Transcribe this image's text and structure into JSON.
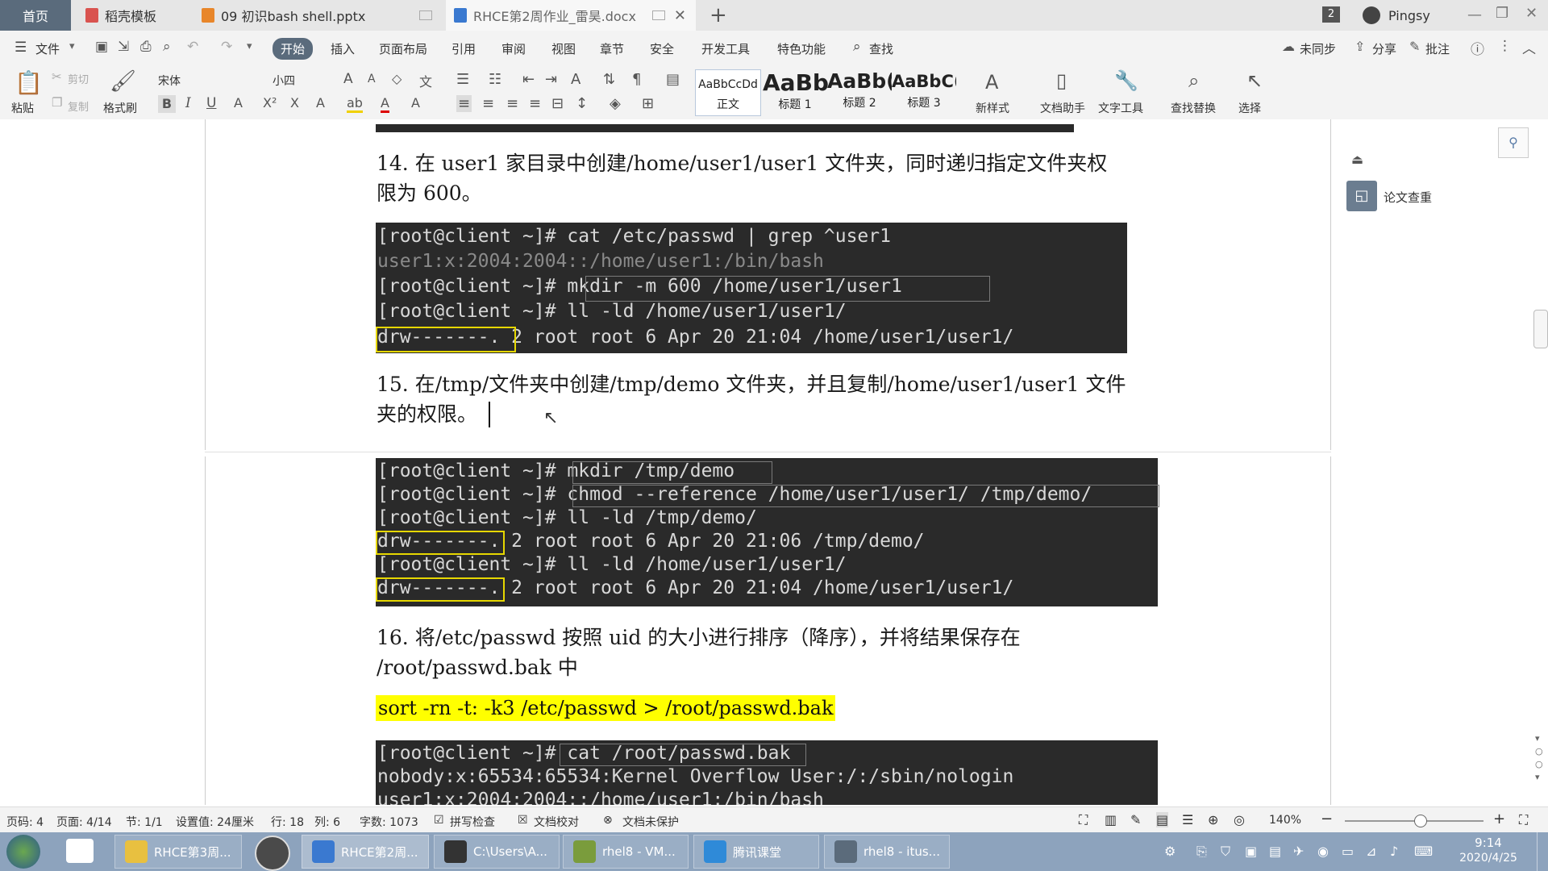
{
  "tabs": [
    {
      "label": "首页"
    },
    {
      "label": "稻壳模板"
    },
    {
      "label": "09 初识bash shell.pptx"
    },
    {
      "label": "RHCE第2周作业_雷昊.docx"
    }
  ],
  "titlebar": {
    "badge": "2",
    "user": "Pingsy"
  },
  "menu": [
    "文件",
    "开始",
    "插入",
    "页面布局",
    "引用",
    "审阅",
    "视图",
    "章节",
    "安全",
    "开发工具",
    "特色功能",
    "查找"
  ],
  "menu_right": [
    "未同步",
    "分享",
    "批注"
  ],
  "ribbon": {
    "paste": "粘贴",
    "cut": "剪切",
    "copy": "复制",
    "format_painter": "格式刷",
    "font": "宋体",
    "size": "小四",
    "styles": [
      {
        "preview": "AaBbCcDd",
        "name": "正文"
      },
      {
        "preview": "AaBb",
        "name": "标题 1"
      },
      {
        "preview": "AaBb(",
        "name": "标题 2"
      },
      {
        "preview": "AaBbC(",
        "name": "标题 3"
      }
    ],
    "new_style": "新样式",
    "doc_helper": "文档助手",
    "text_tools": "文字工具",
    "find_replace": "查找替换",
    "select": "选择"
  },
  "side_panel": {
    "label": "论文查重"
  },
  "doc": {
    "q14_line1": "14. 在 user1 家目录中创建/home/user1/user1 文件夹，同时递归指定文件夹权",
    "q14_line2": "限为 600。",
    "term1": [
      "[root@client ~]# cat /etc/passwd | grep ^user1",
      "user1:x:2004:2004::/home/user1:/bin/bash",
      "[root@client ~]# mkdir -m 600 /home/user1/user1",
      "[root@client ~]# ll -ld /home/user1/user1/",
      "drw-------. 2 root root 6 Apr 20 21:04 /home/user1/user1/"
    ],
    "q15_line1": "15. 在/tmp/文件夹中创建/tmp/demo 文件夹，并且复制/home/user1/user1 文件",
    "q15_line2": "夹的权限。",
    "term2": [
      "[root@client ~]# mkdir /tmp/demo",
      "[root@client ~]# chmod --reference /home/user1/user1/ /tmp/demo/",
      "[root@client ~]# ll -ld /tmp/demo/",
      "drw-------. 2 root root 6 Apr 20 21:06 /tmp/demo/",
      "[root@client ~]# ll -ld /home/user1/user1/",
      "drw-------. 2 root root 6 Apr 20 21:04 /home/user1/user1/"
    ],
    "q16_line1": "16. 将/etc/passwd 按照 uid 的大小进行排序（降序），并将结果保存在",
    "q16_line2": "/root/passwd.bak 中",
    "q16_cmd": "sort -rn -t: -k3 /etc/passwd > /root/passwd.bak",
    "term3": [
      "[root@client ~]# cat /root/passwd.bak",
      "nobody:x:65534:65534:Kernel Overflow User:/:/sbin/nologin",
      "user1:x:2004:2004::/home/user1:/bin/bash"
    ]
  },
  "status": {
    "page": "页码: 4",
    "pages": "页面: 4/14",
    "section": "节: 1/1",
    "setting": "设置值: 24厘米",
    "row": "行: 18",
    "col": "列: 6",
    "words": "字数: 1073",
    "spell": "拼写检查",
    "proof": "文档校对",
    "protect": "文档未保护",
    "zoom": "140%"
  },
  "taskbar": {
    "items": [
      "RHCE第3周...",
      "RHCE第2周...",
      "C:\\Users\\A...",
      "rhel8 - VM...",
      "腾讯课堂",
      "rhel8 - itus..."
    ],
    "time": "9:14",
    "date": "2020/4/25"
  },
  "colors": {
    "tab_home": "#5a6b7c",
    "terminal_bg": "#2a2a2a",
    "highlight": "#ffff00",
    "taskbar": "#8da3bd"
  }
}
